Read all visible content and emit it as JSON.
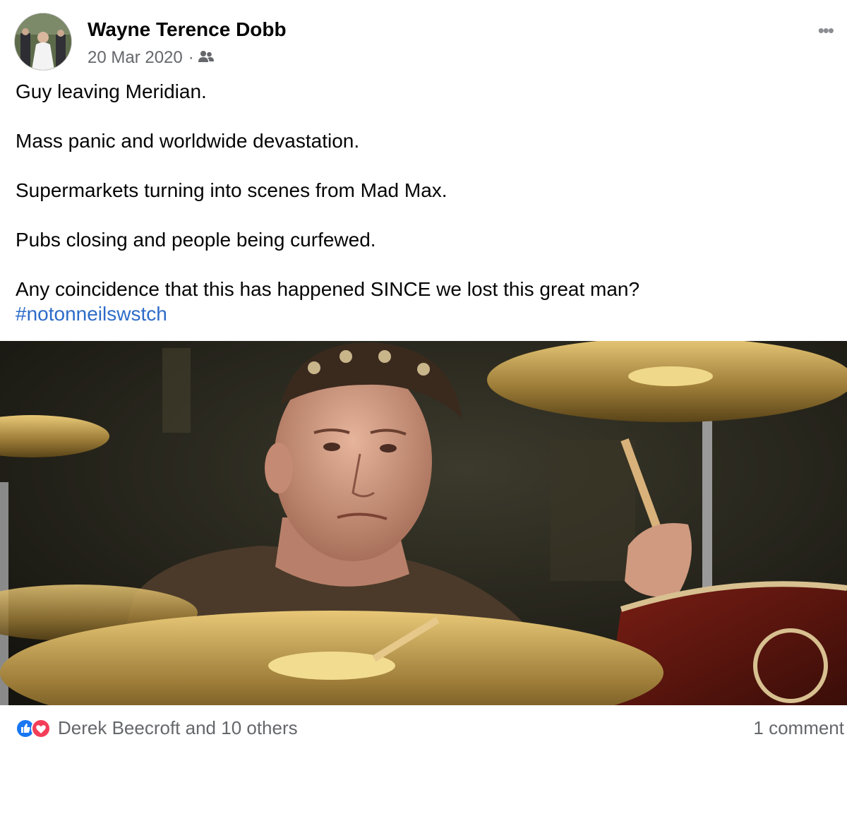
{
  "post": {
    "author": "Wayne Terence Dobb",
    "date": "20 Mar 2020",
    "date_sep": "·",
    "audience_icon": "friends-icon",
    "more_icon": "more-options-icon",
    "more_label": "•••",
    "lines": [
      "Guy leaving Meridian.",
      "Mass panic and worldwide devastation.",
      "Supermarkets turning into scenes from Mad Max.",
      "Pubs closing and people being curfewed.",
      "Any coincidence that this has happened SINCE we lost this great man?"
    ],
    "hashtag": "#notonneilswstch"
  },
  "footer": {
    "reactions_text": "Derek Beecroft and 10 others",
    "reaction_icons": [
      "like-icon",
      "love-icon"
    ],
    "comments_text": "1 comment"
  },
  "colors": {
    "link": "#2d6cc8",
    "secondary_text": "#65676b",
    "like": "#1877f2",
    "love": "#f33e58"
  }
}
